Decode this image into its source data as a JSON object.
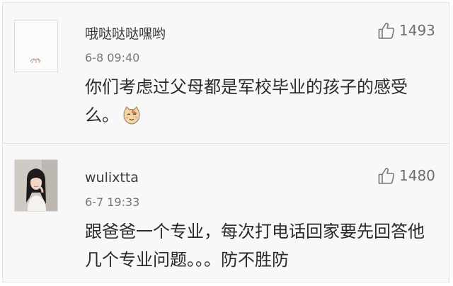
{
  "comments": [
    {
      "username": "哦哒哒哒嘿哟",
      "time": "6-8 09:40",
      "likes": "1493",
      "text": "你们考虑过父母都是军校毕业的孩子的感受么。",
      "emoji": "cat-face-icon",
      "avatar": "doodle-avatar"
    },
    {
      "username": "wulixtta",
      "time": "6-7 19:33",
      "likes": "1480",
      "text": "跟爸爸一个专业，每次打电话回家要先回答他几个专业问题。。。防不胜防",
      "avatar": "girl-photo-avatar"
    }
  ],
  "icons": {
    "like": "thumbs-up-icon"
  },
  "colors": {
    "background": "#f8f8f8",
    "text": "#2a2a2a",
    "meta": "#777777"
  }
}
